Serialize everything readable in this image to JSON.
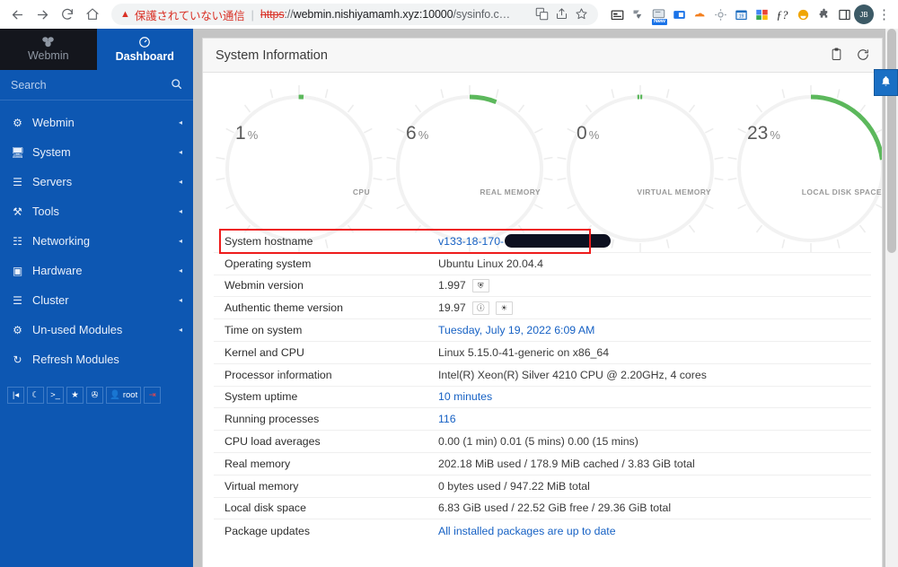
{
  "browser": {
    "nav": {
      "back": "back-arrow",
      "forward": "forward-arrow",
      "reload": "reload",
      "home": "home"
    },
    "security_warning": "保護されていない通信",
    "url": {
      "scheme": "https",
      "sep": "://",
      "host": "webmin.nishiyamamh.xyz:10000",
      "path": "/sysinfo.c…"
    },
    "omni_icons": [
      "translate-icon",
      "share-icon",
      "bookmark-star-icon"
    ],
    "extensions": [
      "news-extension-icon",
      "pin-extension-icon",
      "new-tab-extension-icon",
      "id-card-extension-icon",
      "orange-cloud-extension-icon",
      "settings-gear-extension-icon",
      "calendar-extension-icon",
      "google-colors-extension-icon",
      "f-question-extension-icon",
      "face-extension-icon",
      "puzzle-extensions-icon",
      "side-panel-icon"
    ],
    "avatar_label": "JB",
    "menu": "kebab-menu"
  },
  "sidebar": {
    "tabs": [
      {
        "label": "Webmin",
        "icon": "webmin-logo-icon",
        "active": false
      },
      {
        "label": "Dashboard",
        "icon": "gauge-icon",
        "active": true
      }
    ],
    "search": {
      "placeholder": "Search",
      "value": "",
      "icon": "search-icon"
    },
    "items": [
      {
        "label": "Webmin",
        "icon": "gear-icon",
        "caret": "◂"
      },
      {
        "label": "System",
        "icon": "monitor-icon",
        "caret": "◂"
      },
      {
        "label": "Servers",
        "icon": "server-icon",
        "caret": "◂"
      },
      {
        "label": "Tools",
        "icon": "tools-icon",
        "caret": "◂"
      },
      {
        "label": "Networking",
        "icon": "network-icon",
        "caret": "◂"
      },
      {
        "label": "Hardware",
        "icon": "hardware-icon",
        "caret": "◂"
      },
      {
        "label": "Cluster",
        "icon": "layers-icon",
        "caret": "◂"
      },
      {
        "label": "Un-used Modules",
        "icon": "unused-modules-icon",
        "caret": "◂"
      },
      {
        "label": "Refresh Modules",
        "icon": "refresh-icon",
        "caret": ""
      }
    ],
    "toolbar": [
      {
        "name": "collapse-sidebar-button",
        "glyph": "|◂"
      },
      {
        "name": "night-mode-button",
        "glyph": "☾"
      },
      {
        "name": "terminal-button",
        "glyph": ">_"
      },
      {
        "name": "favorites-button",
        "glyph": "★"
      },
      {
        "name": "theme-palette-button",
        "glyph": "✇"
      },
      {
        "name": "user-button",
        "glyph": "👤",
        "label": "root"
      },
      {
        "name": "logout-button",
        "glyph": "⇥"
      }
    ]
  },
  "card": {
    "title": "System Information",
    "actions": [
      {
        "name": "clipboard-button",
        "glyph": "📋"
      },
      {
        "name": "refresh-button",
        "glyph": "⟳"
      }
    ]
  },
  "chart_data": {
    "type": "gauge",
    "title": "System resource usage gauges",
    "unit": "%",
    "ylim": [
      0,
      100
    ],
    "gauges": [
      {
        "label": "CPU",
        "value": 1,
        "display": "1",
        "symbol": "%",
        "color": "#5cb85c"
      },
      {
        "label": "REAL MEMORY",
        "value": 6,
        "display": "6",
        "symbol": "%",
        "color": "#5cb85c"
      },
      {
        "label": "VIRTUAL MEMORY",
        "value": 0,
        "display": "0",
        "symbol": "%",
        "color": "#5cb85c"
      },
      {
        "label": "LOCAL DISK SPACE",
        "value": 23,
        "display": "23",
        "symbol": "%",
        "color": "#5cb85c"
      }
    ]
  },
  "info": {
    "rows": [
      {
        "key": "System hostname",
        "value": "v133-18-170-",
        "link": true,
        "redacted": true,
        "highlighted": true
      },
      {
        "key": "Operating system",
        "value": "Ubuntu Linux 20.04.4",
        "link": false
      },
      {
        "key": "Webmin version",
        "value": "1.997",
        "link": false,
        "buttons": [
          "upgrade-icon"
        ]
      },
      {
        "key": "Authentic theme version",
        "value": "19.97",
        "link": false,
        "buttons": [
          "info-icon",
          "palette-icon"
        ]
      },
      {
        "key": "Time on system",
        "value": "Tuesday, July 19, 2022 6:09 AM",
        "link": true
      },
      {
        "key": "Kernel and CPU",
        "value": "Linux 5.15.0-41-generic on x86_64",
        "link": false
      },
      {
        "key": "Processor information",
        "value": "Intel(R) Xeon(R) Silver 4210 CPU @ 2.20GHz, 4 cores",
        "link": false
      },
      {
        "key": "System uptime",
        "value": "10 minutes",
        "link": true
      },
      {
        "key": "Running processes",
        "value": "116",
        "link": true
      },
      {
        "key": "CPU load averages",
        "value": "0.00 (1 min) 0.01 (5 mins) 0.00 (15 mins)",
        "link": false
      },
      {
        "key": "Real memory",
        "value": "202.18 MiB used / 178.9 MiB cached / 3.83 GiB total",
        "link": false
      },
      {
        "key": "Virtual memory",
        "value": "0 bytes used / 947.22 MiB total",
        "link": false
      },
      {
        "key": "Local disk space",
        "value": "6.83 GiB used / 22.52 GiB free / 29.36 GiB total",
        "link": false
      },
      {
        "key": "Package updates",
        "value": "All installed packages are up to date",
        "link": true
      }
    ]
  },
  "notifications": {
    "icon": "bell-icon"
  },
  "colors": {
    "sidebar_blue": "#0d57b2",
    "tab_dark": "#14161d",
    "gauge_green": "#5cb85c",
    "link_blue": "#1661c4",
    "highlight_red": "#ee1c1c"
  }
}
